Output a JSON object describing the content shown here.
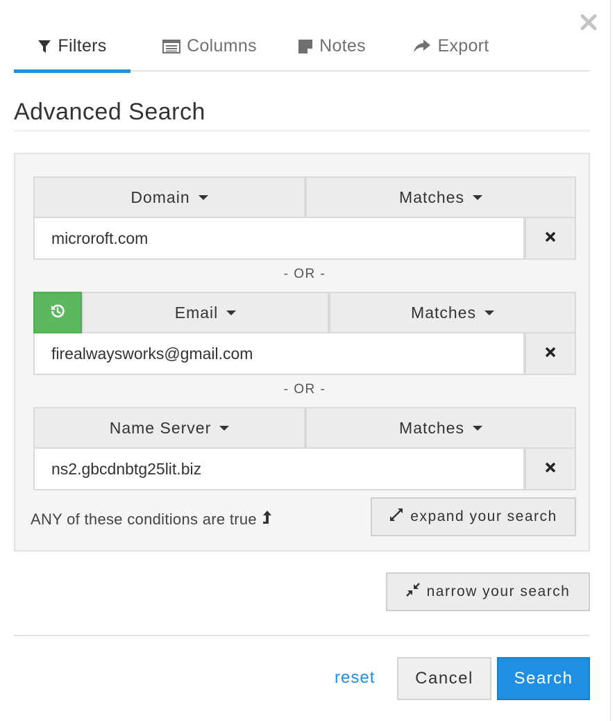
{
  "tabs": [
    {
      "label": "Filters",
      "icon": "filter-icon",
      "active": true
    },
    {
      "label": "Columns",
      "icon": "columns-icon",
      "active": false
    },
    {
      "label": "Notes",
      "icon": "notes-icon",
      "active": false
    },
    {
      "label": "Export",
      "icon": "share-arrow-icon",
      "active": false
    }
  ],
  "title": "Advanced Search",
  "conditions": [
    {
      "field": "Domain",
      "operator": "Matches",
      "value": "microroft.com"
    },
    {
      "field": "Email",
      "operator": "Matches",
      "value": "firealwaysworks@gmail.com"
    },
    {
      "field": "Name Server",
      "operator": "Matches",
      "value": "ns2.gbcdnbtg25lit.biz"
    }
  ],
  "separator": "- OR -",
  "logic_text": "ANY of these conditions are true",
  "expand_label": "expand your search",
  "narrow_label": "narrow your search",
  "footer": {
    "reset_label": "reset",
    "cancel_label": "Cancel",
    "search_label": "Search"
  },
  "colors": {
    "accent": "#1e8fe1",
    "history_green": "#5cb85c"
  }
}
